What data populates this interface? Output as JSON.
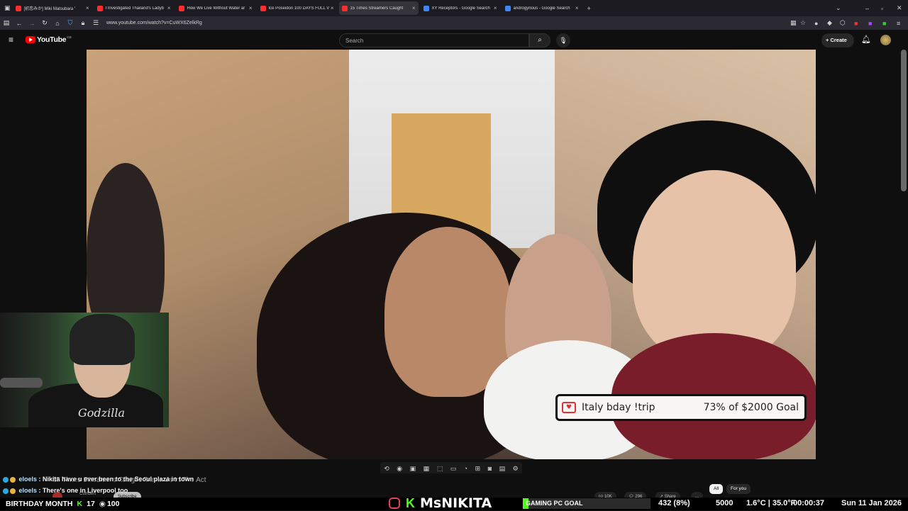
{
  "browser": {
    "tabs": [
      {
        "title": "[初恋みか] Miki Matsubara '",
        "color": "#ff2d2d",
        "active": false
      },
      {
        "title": "I Investigated Thailand's Ladyb",
        "color": "#ff2d2d",
        "active": false
      },
      {
        "title": "How We Live Without Water ar",
        "color": "#ff2d2d",
        "active": false
      },
      {
        "title": "Ice Poseidon 100 DAYS FULL V",
        "color": "#ff2d2d",
        "active": false
      },
      {
        "title": "15 Times Streamers Caught",
        "color": "#ff2d2d",
        "active": true
      },
      {
        "title": "XY Receptors - Google Search",
        "color": "#4285f4",
        "active": false
      },
      {
        "title": "androgynous - Google Search",
        "color": "#4285f4",
        "active": false
      }
    ],
    "new_tab": "+",
    "url": "www.youtube.com/watch?v=CuWX6ZelkRg"
  },
  "youtube": {
    "logo": "YouTube",
    "logo_sup": "GB",
    "search_placeholder": "Search",
    "create_label": "Create"
  },
  "stream_overlay": {
    "goal_title": "Italy bday !trip",
    "goal_progress": "73% of $2000 Goal",
    "webcam_shirt_text": "Godzilla"
  },
  "chat": [
    {
      "user": "eloels",
      "message": "Nikita have u ever been to the Seoul plaza in town"
    },
    {
      "user": "eloels",
      "message": "There's one in Liverpool too"
    }
  ],
  "video_title": "15 Times Streamers Caught Criminals In The Act",
  "ticker": {
    "left": "BIRTHDAY MONTH",
    "kick_count": "17",
    "viewers": "100",
    "streamer_name": "MsNIKITA",
    "goal_label": "GAMING PC GOAL",
    "goal_value": "432 (8%)",
    "goal_target": "5000",
    "weather": "1.6°C | 35.0°F",
    "uptime": "00:00:37",
    "date": "Sun 11 Jan 2026"
  },
  "video_actions": {
    "likes": "10K",
    "comments": "296",
    "share": "Share",
    "more": "...",
    "chip_all": "All",
    "chip_foryou": "For you",
    "channel": "Cuthbert",
    "subscribe": "Subscribe"
  }
}
